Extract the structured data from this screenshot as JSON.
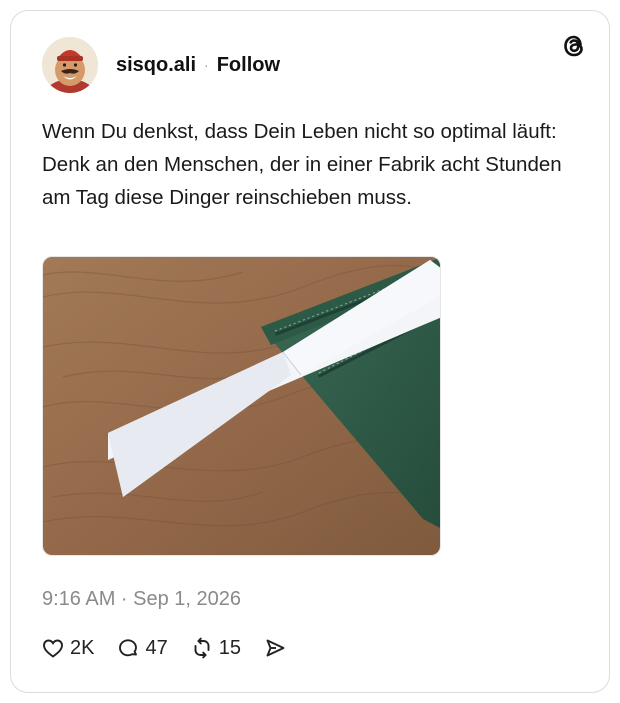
{
  "post": {
    "username": "sisqo.ali",
    "separator": "·",
    "follow_label": "Follow",
    "text": "Wenn Du denkst, dass Dein Leben nicht so optimal läuft: Denk an den Menschen, der in einer Fabrik acht Stunden am Tag diese Dinger reinschieben muss.",
    "timestamp": "9:16 AM · Sep 1, 2026",
    "image_description_icon": "photo-of-paper-strip-on-green-folder"
  },
  "actions": {
    "likes": "2K",
    "replies": "47",
    "reposts": "15"
  },
  "icons": {
    "brand": "threads-logo-icon",
    "like": "heart-icon",
    "reply": "comment-icon",
    "repost": "repost-icon",
    "share": "share-icon"
  },
  "colors": {
    "border": "#dcdcdc",
    "timestamp": "#8a8a8a",
    "folder_green": "#2f5d4a",
    "wood": "#9b7250"
  }
}
